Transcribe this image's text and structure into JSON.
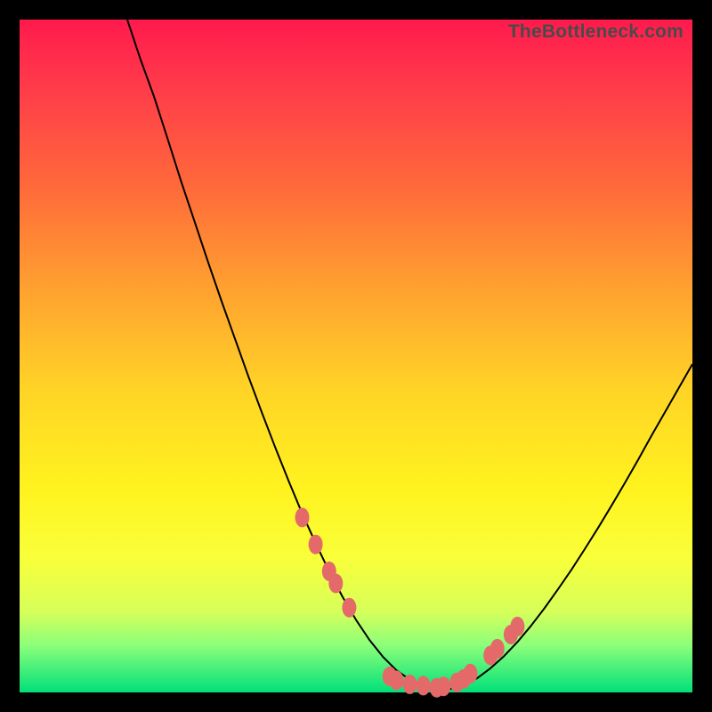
{
  "watermark": "TheBottleneck.com",
  "colors": {
    "marker": "#e46a6a",
    "line": "#000000",
    "frame": "#000000",
    "gradient_top": "#ff1a4d",
    "gradient_bottom": "#00e07a"
  },
  "chart_data": {
    "type": "line",
    "title": "",
    "xlabel": "",
    "ylabel": "",
    "xlim": [
      0,
      100
    ],
    "ylim": [
      0,
      100
    ],
    "grid": false,
    "legend": false,
    "x": [
      0,
      2,
      4,
      6,
      8,
      10,
      12,
      14,
      16,
      18,
      20,
      22,
      24,
      26,
      28,
      30,
      32,
      34,
      36,
      38,
      40,
      42,
      44,
      46,
      48,
      50,
      52,
      54,
      56,
      58,
      60,
      62,
      64,
      66,
      68,
      70,
      72,
      74,
      76,
      78,
      80,
      82,
      84,
      86,
      88,
      90,
      92,
      94,
      96,
      98,
      100
    ],
    "values": [
      null,
      null,
      null,
      null,
      null,
      null,
      null,
      null,
      100,
      94,
      88.5,
      82.3,
      76,
      70,
      64,
      58.2,
      52.6,
      47,
      41.6,
      36.4,
      31.4,
      26.6,
      22.2,
      18,
      14.2,
      10.8,
      7.8,
      5.3,
      3.3,
      1.9,
      1.0,
      0.5,
      0.5,
      1.1,
      2.1,
      3.6,
      5.4,
      7.5,
      9.9,
      12.5,
      15.3,
      18.2,
      21.3,
      24.5,
      27.8,
      31.2,
      34.7,
      38.3,
      41.8,
      45.3,
      48.8
    ],
    "markers": {
      "x": [
        42,
        44,
        46,
        47,
        49,
        55,
        56,
        58,
        60,
        62,
        63,
        65,
        66,
        67,
        70,
        71,
        73,
        74
      ],
      "y": [
        26.0,
        22.0,
        18.0,
        16.2,
        12.6,
        2.4,
        1.8,
        1.2,
        1.0,
        0.7,
        0.9,
        1.5,
        2.0,
        2.8,
        5.5,
        6.5,
        8.6,
        9.8
      ]
    }
  }
}
